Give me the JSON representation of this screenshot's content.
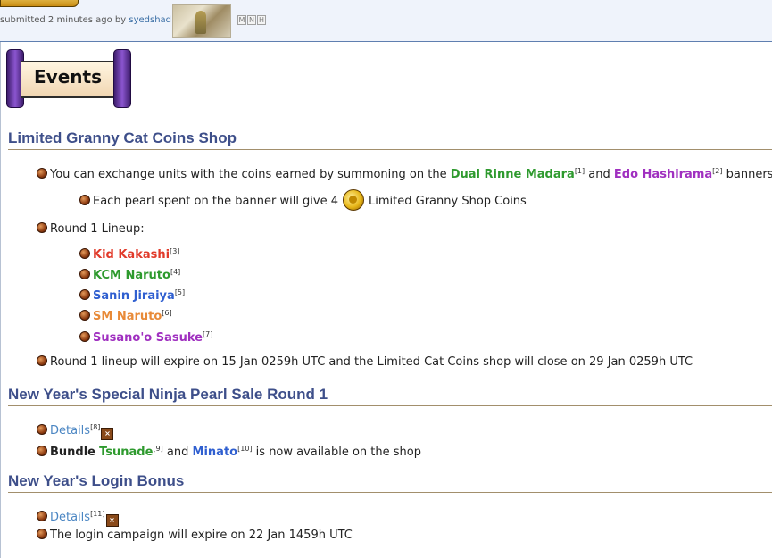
{
  "topbar": {
    "submitted_prefix": "submitted 2 minutes ago by",
    "author": "syedshad",
    "flair": [
      "M",
      "N",
      "H"
    ]
  },
  "banner": {
    "title": "Events"
  },
  "sections": {
    "granny": {
      "title": "Limited Granny Cat Coins Shop",
      "intro_prefix": "You can exchange units with the coins earned by summoning on the",
      "unit1": "Dual Rinne Madara",
      "ref1": "[1]",
      "and": "and",
      "unit2": "Edo Hashirama",
      "ref2": "[2]",
      "intro_suffix": "banners.",
      "pearl_prefix": "Each pearl spent on the banner will give 4",
      "pearl_suffix": "Limited Granny Shop Coins",
      "lineup_label": "Round 1 Lineup:",
      "lineup": [
        {
          "name": "Kid Kakashi",
          "ref": "[3]"
        },
        {
          "name": "KCM Naruto",
          "ref": "[4]"
        },
        {
          "name": "Sanin Jiraiya",
          "ref": "[5]"
        },
        {
          "name": "SM Naruto",
          "ref": "[6]"
        },
        {
          "name": "Susano'o Sasuke",
          "ref": "[7]"
        }
      ],
      "expire": "Round 1 lineup will expire on 15 Jan 0259h UTC and the Limited Cat Coins shop will close on 29 Jan 0259h UTC"
    },
    "pearl_sale": {
      "title": "New Year's Special Ninja Pearl Sale Round 1",
      "details": "Details",
      "details_ref": "[8]",
      "bundle_label": "Bundle",
      "unit1": "Tsunade",
      "ref1": "[9]",
      "and": "and",
      "unit2": "Minato",
      "ref2": "[10]",
      "suffix": "is now available on the shop"
    },
    "login": {
      "title": "New Year's Login Bonus",
      "details": "Details",
      "details_ref": "[11]",
      "expire": "The login campaign will expire on 22 Jan 1459h UTC"
    }
  },
  "icons": {
    "expand": "x-box-icon",
    "coin": "coin-icon",
    "bullet": "bullet-icon"
  },
  "colors": {
    "section_title": "#3e4f8a",
    "green": "#2e9a2e",
    "purple": "#a030c0",
    "red": "#e13a2a",
    "blue": "#2f5fd0",
    "orange": "#e88a38",
    "link": "#4b86c3"
  }
}
